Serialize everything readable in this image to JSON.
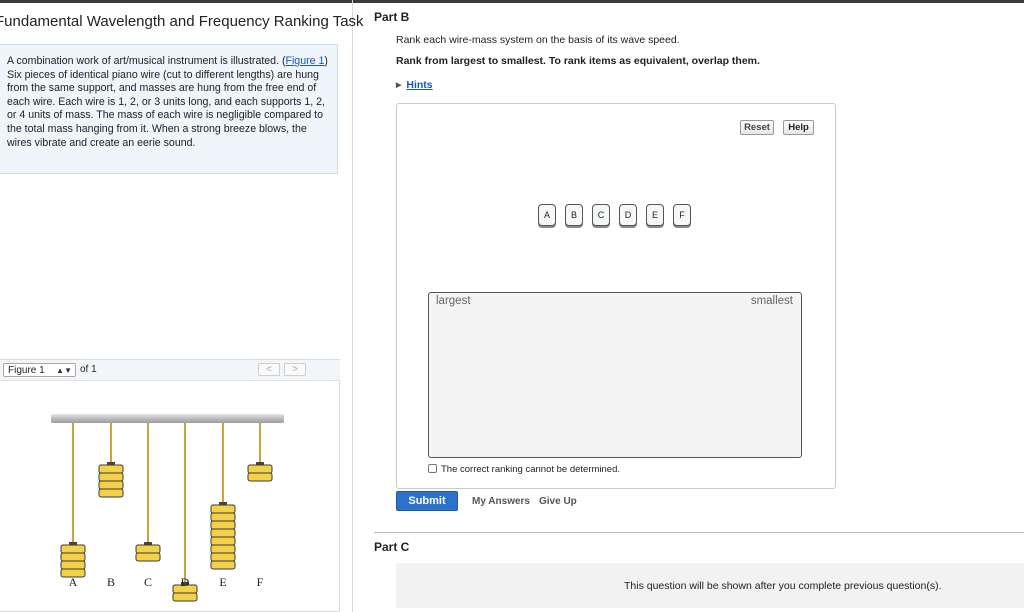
{
  "task": {
    "title": "Fundamental Wavelength and Frequency Ranking Task"
  },
  "intro": {
    "text_before_link": "A combination work of art/musical instrument is illustrated. (",
    "figure_link": "Figure 1",
    "text_after_link": ") Six pieces of identical piano wire (cut to different lengths) are hung from the same support, and masses are hung from the free end of each wire. Each wire is 1, 2, or 3 units long, and each supports 1, 2, or 4 units of mass. The mass of each wire is negligible compared to the total mass hanging from it. When a strong breeze blows, the wires vibrate and create an eerie sound."
  },
  "figure": {
    "selector_value": "Figure 1",
    "of_label": "of 1",
    "prev_glyph": "<",
    "next_glyph": ">",
    "wires": [
      {
        "label": "A",
        "length_units": 3,
        "mass_units": 4
      },
      {
        "label": "B",
        "length_units": 1,
        "mass_units": 4
      },
      {
        "label": "C",
        "length_units": 3,
        "mass_units": 2
      },
      {
        "label": "D",
        "length_units": 4,
        "mass_units": 2
      },
      {
        "label": "E",
        "length_units": 2,
        "mass_units": 8
      },
      {
        "label": "F",
        "length_units": 1,
        "mass_units": 2
      }
    ]
  },
  "partB": {
    "title": "Part B",
    "prompt": "Rank each wire-mass system on the basis of its wave speed.",
    "instruction": "Rank from largest to smallest. To rank items as equivalent, overlap them.",
    "hints_label": "Hints",
    "reset_label": "Reset",
    "help_label": "Help",
    "tiles": [
      "A",
      "B",
      "C",
      "D",
      "E",
      "F"
    ],
    "rank_largest": "largest",
    "rank_smallest": "smallest",
    "cannot_determine_label": "The correct ranking cannot be determined.",
    "submit_label": "Submit",
    "my_answers_label": "My Answers",
    "give_up_label": "Give Up"
  },
  "partC": {
    "title": "Part C",
    "message": "This question will be shown after you complete previous question(s)."
  },
  "colors": {
    "link": "#1a57b5",
    "submit_bg": "#2b72c9",
    "intro_bg": "#eef5fb",
    "mass_fill": "#f3d14a",
    "wire": "#c8a23a",
    "support_bar": "#c9c9c9"
  }
}
